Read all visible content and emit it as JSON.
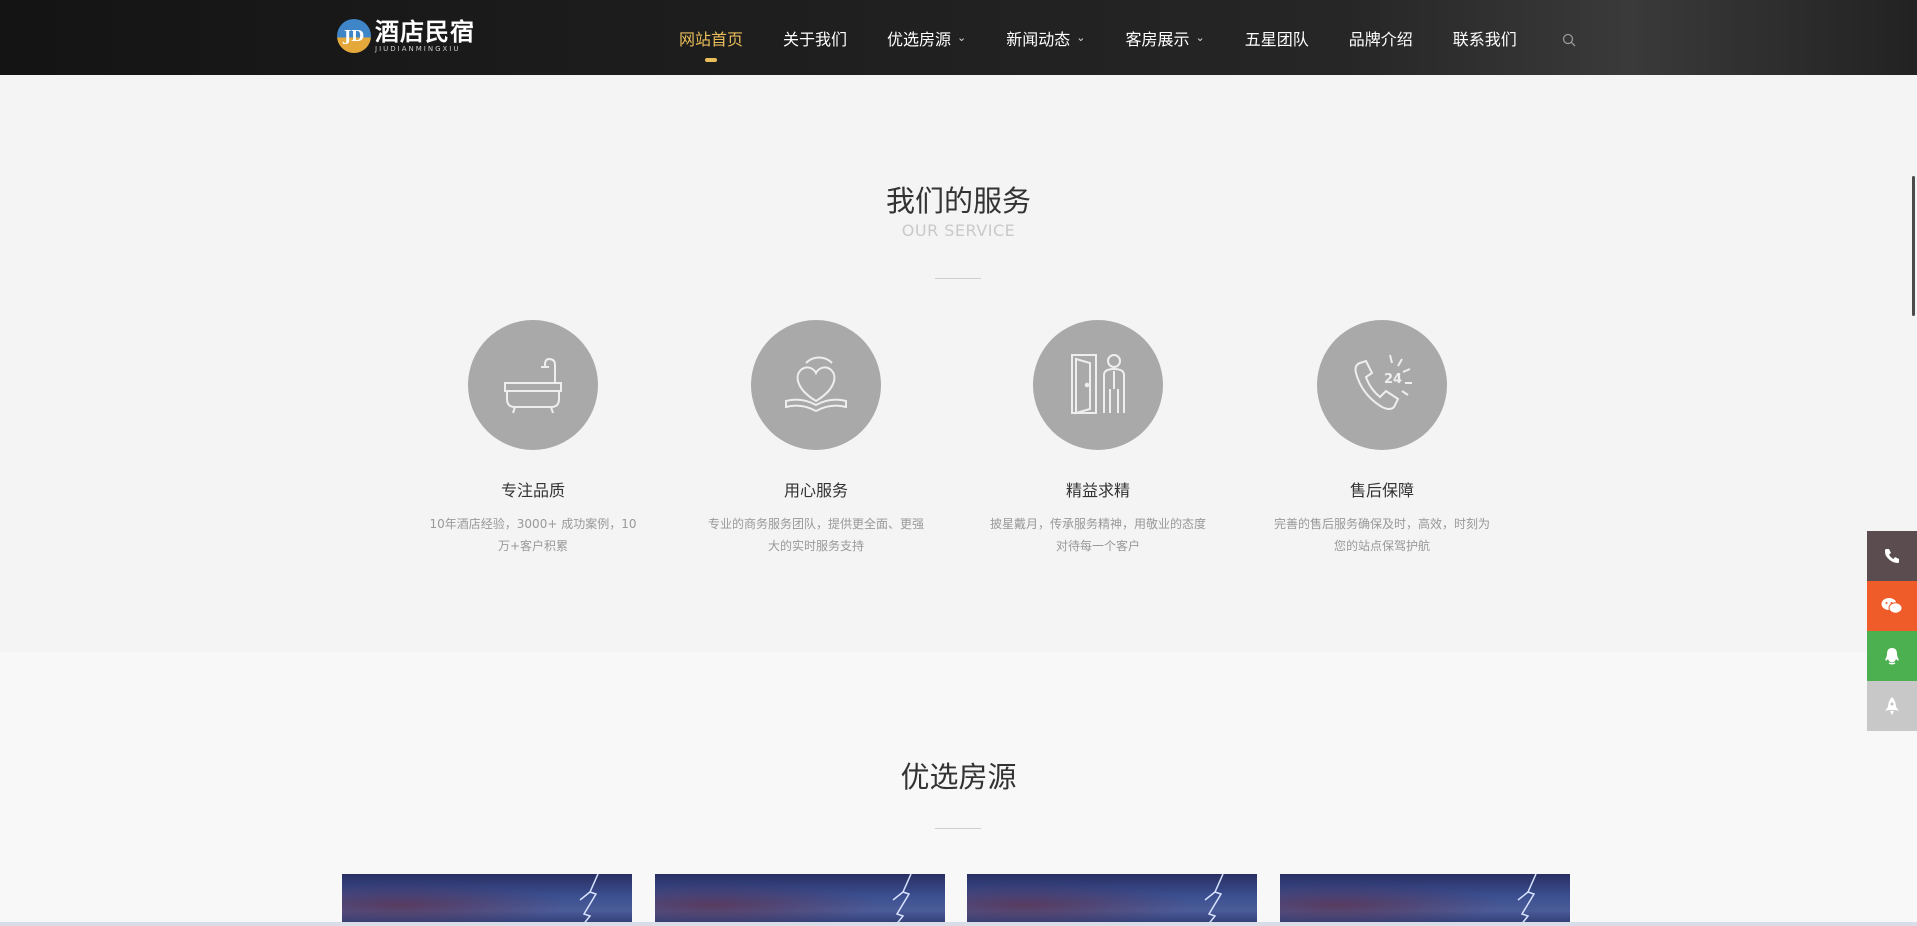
{
  "header": {
    "logo": {
      "mark": "JD",
      "cn": "酒店民宿",
      "en": "JIUDIANMINGXIU"
    },
    "nav": [
      {
        "label": "网站首页",
        "active": true,
        "dropdown": false
      },
      {
        "label": "关于我们",
        "active": false,
        "dropdown": false
      },
      {
        "label": "优选房源",
        "active": false,
        "dropdown": true
      },
      {
        "label": "新闻动态",
        "active": false,
        "dropdown": true
      },
      {
        "label": "客房展示",
        "active": false,
        "dropdown": true
      },
      {
        "label": "五星团队",
        "active": false,
        "dropdown": false
      },
      {
        "label": "品牌介绍",
        "active": false,
        "dropdown": false
      },
      {
        "label": "联系我们",
        "active": false,
        "dropdown": false
      }
    ],
    "chevron": "⌄",
    "accent": "#e9bd5a"
  },
  "service": {
    "title": "我们的服务",
    "subtitle": "OUR SERVICE",
    "items": [
      {
        "icon": "bathtub-icon",
        "title": "专注品质",
        "desc": "10年酒店经验，3000+ 成功案例，10万+客户积累"
      },
      {
        "icon": "heart-book-icon",
        "title": "用心服务",
        "desc": "专业的商务服务团队，提供更全面、更强大的实时服务支持"
      },
      {
        "icon": "door-person-icon",
        "title": "精益求精",
        "desc": "披星戴月，传承服务精神，用敬业的态度对待每一个客户"
      },
      {
        "icon": "phone-24-icon",
        "title": "售后保障",
        "desc": "完善的售后服务确保及时，高效，时刻为您的站点保驾护航"
      }
    ]
  },
  "rooms": {
    "title": "优选房源"
  },
  "sidebar": {
    "items": [
      {
        "icon": "phone-icon",
        "color": "#5a4c4f"
      },
      {
        "icon": "wechat-icon",
        "color": "#f05b2a"
      },
      {
        "icon": "qq-icon",
        "color": "#4caf50"
      },
      {
        "icon": "rocket-top-icon",
        "color": "#c8c8c8"
      }
    ]
  }
}
